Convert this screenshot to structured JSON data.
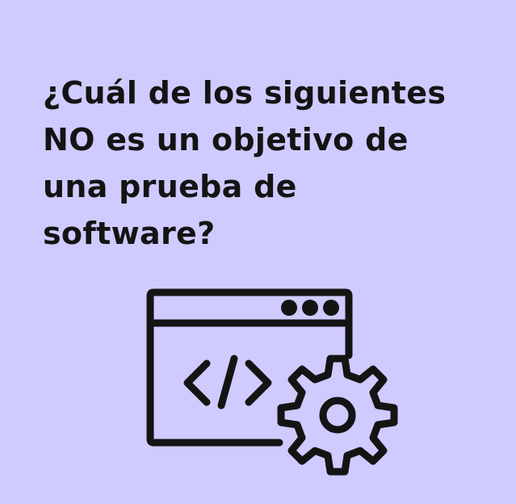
{
  "question": {
    "line1": "¿Cuál de los siguientes",
    "line2": "NO es un objetivo de",
    "line3": "una prueba de",
    "line4": "software?"
  },
  "illustration": {
    "icon": "code-window-with-gear-icon",
    "code_glyph": "</>"
  },
  "colors": {
    "background": "#cfcbff",
    "foreground": "#141414"
  }
}
